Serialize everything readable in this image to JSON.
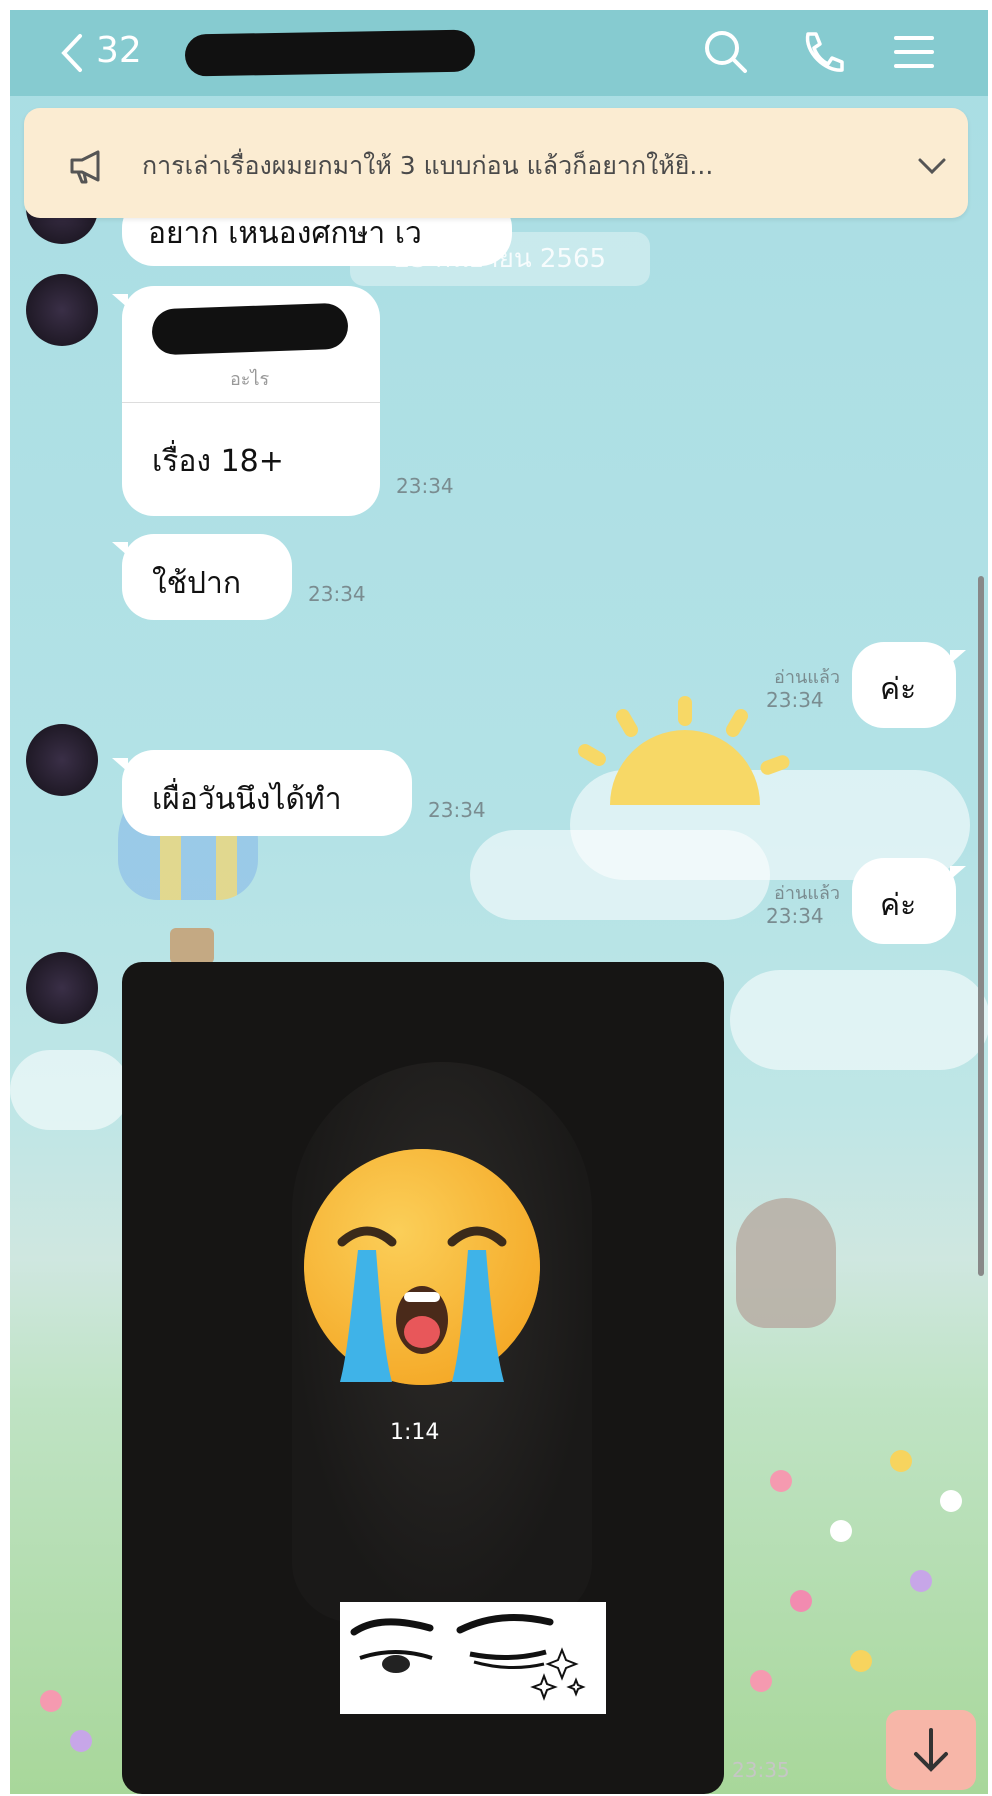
{
  "header": {
    "back_count": "32",
    "icons": [
      "back-chevron-icon",
      "search-icon",
      "phone-icon",
      "menu-icon"
    ]
  },
  "announcement": {
    "text": "การเล่าเรื่องผมยกมาให้ 3 แบบก่อน แล้วก็อยากให้ยิ..."
  },
  "background": {
    "date_pill": "23 กันยายน 2565"
  },
  "messages": {
    "m0": {
      "text": "อยาก เหนองศกษา เว"
    },
    "m1": {
      "sub": "อะไร",
      "text": "เรื่อง 18+",
      "time": "23:34"
    },
    "m2": {
      "text": "ใช้ปาก",
      "time": "23:34"
    },
    "m3": {
      "text": "ค่ะ",
      "read": "อ่านแล้ว",
      "time": "23:34"
    },
    "m4": {
      "text": "เผื่อวันนึงได้ทำ",
      "time": "23:34"
    },
    "m5": {
      "text": "ค่ะ",
      "read": "อ่านแล้ว",
      "time": "23:34"
    },
    "video": {
      "duration": "1:14",
      "time": "23:35"
    }
  },
  "colors": {
    "header": "#86cbd0",
    "announcement_bg": "#fbecd2",
    "bubble": "#ffffff",
    "scroll_button": "#f7b6a8"
  }
}
